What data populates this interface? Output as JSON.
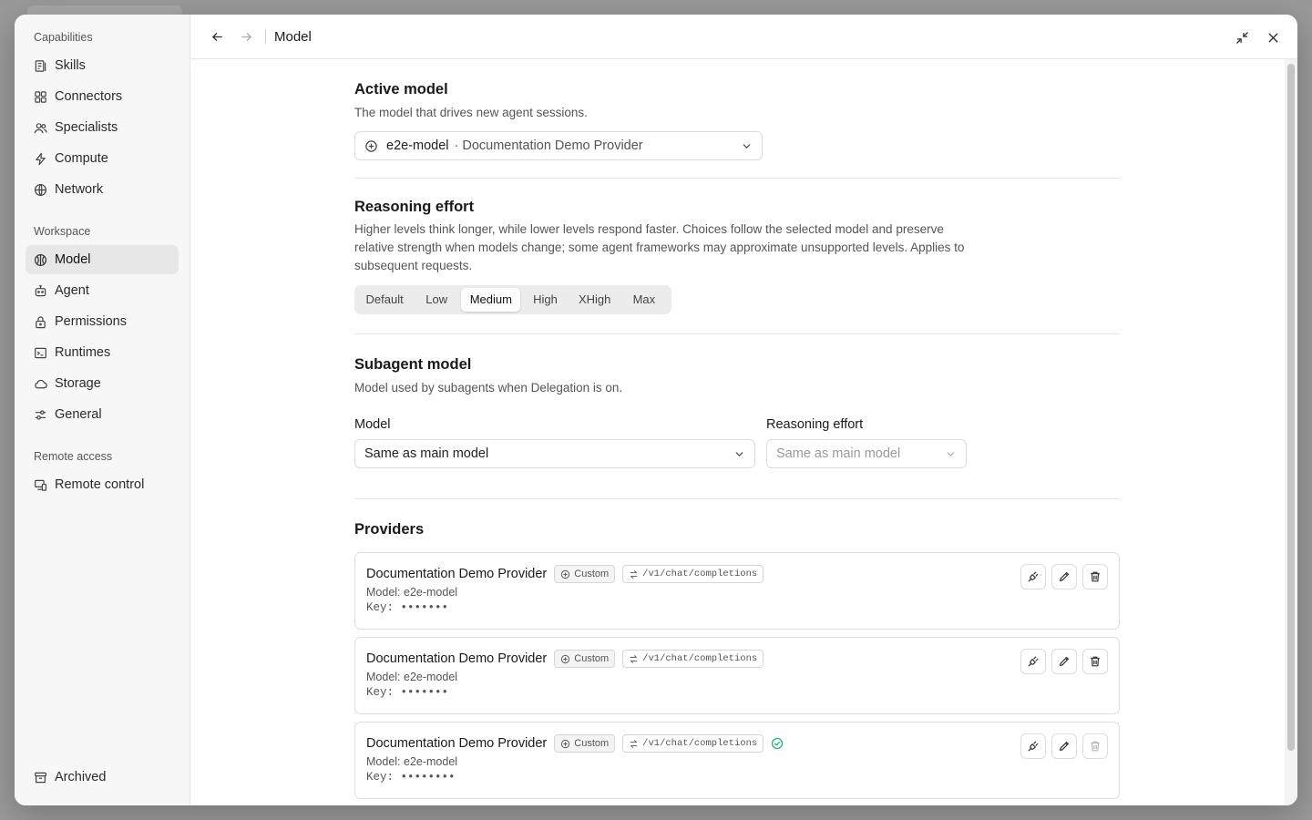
{
  "sidebar": {
    "groups": [
      {
        "label": "Capabilities",
        "items": [
          {
            "label": "Skills",
            "icon": "skills-icon"
          },
          {
            "label": "Connectors",
            "icon": "connectors-icon"
          },
          {
            "label": "Specialists",
            "icon": "specialists-icon"
          },
          {
            "label": "Compute",
            "icon": "compute-icon"
          },
          {
            "label": "Network",
            "icon": "network-icon"
          }
        ]
      },
      {
        "label": "Workspace",
        "items": [
          {
            "label": "Model",
            "icon": "model-icon",
            "active": true
          },
          {
            "label": "Agent",
            "icon": "agent-icon"
          },
          {
            "label": "Permissions",
            "icon": "lock-icon"
          },
          {
            "label": "Runtimes",
            "icon": "terminal-icon"
          },
          {
            "label": "Storage",
            "icon": "cloud-icon"
          },
          {
            "label": "General",
            "icon": "sliders-icon"
          }
        ]
      },
      {
        "label": "Remote access",
        "items": [
          {
            "label": "Remote control",
            "icon": "remote-icon"
          }
        ]
      }
    ],
    "archived": "Archived"
  },
  "topbar": {
    "title": "Model"
  },
  "active_model": {
    "title": "Active model",
    "description": "The model that drives new agent sessions.",
    "model": "e2e-model",
    "provider": "· Documentation Demo Provider"
  },
  "reasoning": {
    "title": "Reasoning effort",
    "description": "Higher levels think longer, while lower levels respond faster. Choices follow the selected model and preserve relative strength when models change; some agent frameworks may approximate unsupported levels. Applies to subsequent requests.",
    "options": [
      "Default",
      "Low",
      "Medium",
      "High",
      "XHigh",
      "Max"
    ],
    "selected": "Medium"
  },
  "subagent": {
    "title": "Subagent model",
    "description": "Model used by subagents when Delegation is on.",
    "model_label": "Model",
    "model_value": "Same as main model",
    "effort_label": "Reasoning effort",
    "effort_value": "Same as main model"
  },
  "providers": {
    "title": "Providers",
    "items": [
      {
        "name": "Documentation Demo Provider",
        "type": "Custom",
        "endpoint": "/v1/chat/completions",
        "model": "Model: e2e-model",
        "key": "Key: •••••••",
        "verified": false
      },
      {
        "name": "Documentation Demo Provider",
        "type": "Custom",
        "endpoint": "/v1/chat/completions",
        "model": "Model: e2e-model",
        "key": "Key: •••••••",
        "verified": false
      },
      {
        "name": "Documentation Demo Provider",
        "type": "Custom",
        "endpoint": "/v1/chat/completions",
        "model": "Model: e2e-model",
        "key": "Key: ••••••••",
        "verified": true
      }
    ]
  },
  "colors": {
    "accent_ok": "#2bb673"
  }
}
